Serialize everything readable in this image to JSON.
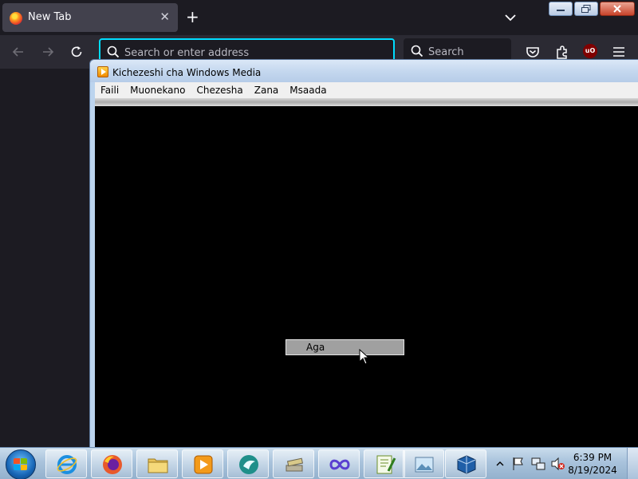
{
  "browser": {
    "tab_title": "New Tab",
    "url_placeholder": "Search or enter address",
    "search_label": "Search",
    "ublock_badge": "uO"
  },
  "wmp": {
    "title": "Kichezeshi cha Windows Media",
    "menu": [
      "Faili",
      "Muonekano",
      "Chezesha",
      "Zana",
      "Msaada"
    ],
    "popup_label": "Aga"
  },
  "taskbar": {
    "time": "6:39 PM",
    "date": "8/19/2024",
    "apps": [
      "internet-explorer",
      "firefox",
      "file-explorer",
      "media-player",
      "browser-app",
      "file-manager-app",
      "infinity-app",
      "notepad-plus-plus",
      "image-viewer",
      "virtualbox"
    ]
  }
}
